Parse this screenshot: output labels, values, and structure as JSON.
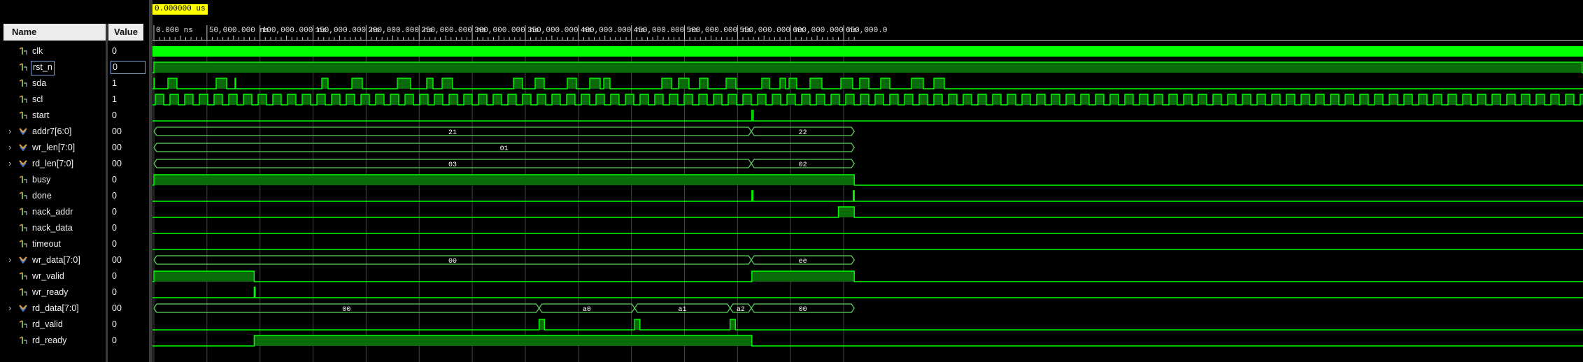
{
  "columns": {
    "name": "Name",
    "value": "Value"
  },
  "cursor": {
    "label": "0.000000 us"
  },
  "colors": {
    "wave": "#00ff00",
    "wave_fill": "#0a6b0a",
    "bus": "#5fd35f",
    "grid": "#3d4a3d",
    "tick": "#c8c8c8"
  },
  "timeline": {
    "ticks": [
      "0.000 ns",
      "50,000.000 ns",
      "100,000.000 ns",
      "150,000.000 ns",
      "200,000.000 ns",
      "250,000.000 ns",
      "300,000.000 ns",
      "350,000.000 ns",
      "400,000.000 ns",
      "450,000.000 ns",
      "500,000.000 ns",
      "550,000.000 ns",
      "600,000.000 ns",
      "650,000.0"
    ]
  },
  "signals": [
    {
      "name": "clk",
      "value": "0",
      "type": "bit",
      "icon": "bit-signal-icon"
    },
    {
      "name": "rst_n",
      "value": "0",
      "type": "bit",
      "icon": "bit-signal-icon",
      "selected": true
    },
    {
      "name": "sda",
      "value": "1",
      "type": "bit",
      "icon": "bit-signal-icon"
    },
    {
      "name": "scl",
      "value": "1",
      "type": "bit",
      "icon": "bit-signal-icon"
    },
    {
      "name": "start",
      "value": "0",
      "type": "bit",
      "icon": "bit-signal-icon"
    },
    {
      "name": "addr7[6:0]",
      "value": "00",
      "type": "bus",
      "icon": "bus-signal-icon",
      "segments": [
        "21",
        "22"
      ]
    },
    {
      "name": "wr_len[7:0]",
      "value": "00",
      "type": "bus",
      "icon": "bus-signal-icon",
      "segments": [
        "01"
      ]
    },
    {
      "name": "rd_len[7:0]",
      "value": "00",
      "type": "bus",
      "icon": "bus-signal-icon",
      "segments": [
        "03",
        "02"
      ]
    },
    {
      "name": "busy",
      "value": "0",
      "type": "bit",
      "icon": "bit-signal-icon"
    },
    {
      "name": "done",
      "value": "0",
      "type": "bit",
      "icon": "bit-signal-icon"
    },
    {
      "name": "nack_addr",
      "value": "0",
      "type": "bit",
      "icon": "bit-signal-icon"
    },
    {
      "name": "nack_data",
      "value": "0",
      "type": "bit",
      "icon": "bit-signal-icon"
    },
    {
      "name": "timeout",
      "value": "0",
      "type": "bit",
      "icon": "bit-signal-icon"
    },
    {
      "name": "wr_data[7:0]",
      "value": "00",
      "type": "bus",
      "icon": "bus-signal-icon",
      "segments": [
        "00",
        "ee"
      ]
    },
    {
      "name": "wr_valid",
      "value": "0",
      "type": "bit",
      "icon": "bit-signal-icon"
    },
    {
      "name": "wr_ready",
      "value": "0",
      "type": "bit",
      "icon": "bit-signal-icon"
    },
    {
      "name": "rd_data[7:0]",
      "value": "00",
      "type": "bus",
      "icon": "bus-signal-icon",
      "segments": [
        "00",
        "a0",
        "a1",
        "a2",
        "00"
      ]
    },
    {
      "name": "rd_valid",
      "value": "0",
      "type": "bit",
      "icon": "bit-signal-icon"
    },
    {
      "name": "rd_ready",
      "value": "0",
      "type": "bit",
      "icon": "bit-signal-icon"
    }
  ]
}
